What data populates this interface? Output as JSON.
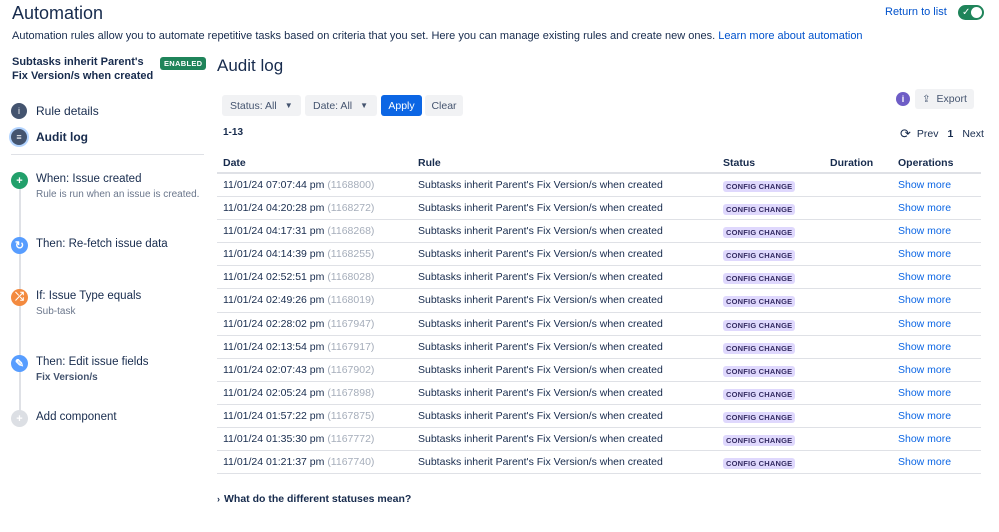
{
  "header": {
    "title": "Automation",
    "description": "Automation rules allow you to automate repetitive tasks based on criteria that you set. Here you can manage existing rules and create new ones.",
    "learn_more": "Learn more about automation",
    "return_link": "Return to list",
    "rule_toggle_on": true
  },
  "sidebar": {
    "rule_name": "Subtasks inherit Parent's Fix Version/s when created",
    "badge": "ENABLED",
    "nav": [
      {
        "label": "Rule details",
        "icon": "info-icon"
      },
      {
        "label": "Audit log",
        "icon": "log-icon",
        "active": true
      }
    ],
    "flow": [
      {
        "title": "When: Issue created",
        "sub": "Rule is run when an issue is created.",
        "icon": "plus-icon",
        "color": "#22a06b"
      },
      {
        "title": "Then: Re-fetch issue data",
        "sub": "",
        "icon": "refresh-icon",
        "color": "#579dff"
      },
      {
        "title": "If: Issue Type equals",
        "sub": "Sub-task",
        "icon": "branch-icon",
        "color": "#f38a3f"
      },
      {
        "title": "Then: Edit issue fields",
        "sub": "Fix Version/s",
        "icon": "pencil-icon",
        "color": "#579dff"
      },
      {
        "title": "Add component",
        "sub": "",
        "icon": "plus-icon",
        "color": "#dcdfe4"
      }
    ]
  },
  "main": {
    "title": "Audit log",
    "filters": {
      "status": "Status: All",
      "date": "Date: All",
      "apply": "Apply",
      "clear": "Clear"
    },
    "export": "Export",
    "range": "1-13",
    "pager": {
      "prev": "Prev",
      "page": "1",
      "next": "Next"
    },
    "columns": [
      "Date",
      "Rule",
      "Status",
      "Duration",
      "Operations"
    ],
    "rows": [
      {
        "date": "11/01/24 07:07:44 pm",
        "id": "(1168800)",
        "rule": "Subtasks inherit Parent's Fix Version/s when created",
        "status": "CONFIG CHANGE",
        "duration": "",
        "op": "Show more"
      },
      {
        "date": "11/01/24 04:20:28 pm",
        "id": "(1168272)",
        "rule": "Subtasks inherit Parent's Fix Version/s when created",
        "status": "CONFIG CHANGE",
        "duration": "",
        "op": "Show more"
      },
      {
        "date": "11/01/24 04:17:31 pm",
        "id": "(1168268)",
        "rule": "Subtasks inherit Parent's Fix Version/s when created",
        "status": "CONFIG CHANGE",
        "duration": "",
        "op": "Show more"
      },
      {
        "date": "11/01/24 04:14:39 pm",
        "id": "(1168255)",
        "rule": "Subtasks inherit Parent's Fix Version/s when created",
        "status": "CONFIG CHANGE",
        "duration": "",
        "op": "Show more"
      },
      {
        "date": "11/01/24 02:52:51 pm",
        "id": "(1168028)",
        "rule": "Subtasks inherit Parent's Fix Version/s when created",
        "status": "CONFIG CHANGE",
        "duration": "",
        "op": "Show more"
      },
      {
        "date": "11/01/24 02:49:26 pm",
        "id": "(1168019)",
        "rule": "Subtasks inherit Parent's Fix Version/s when created",
        "status": "CONFIG CHANGE",
        "duration": "",
        "op": "Show more"
      },
      {
        "date": "11/01/24 02:28:02 pm",
        "id": "(1167947)",
        "rule": "Subtasks inherit Parent's Fix Version/s when created",
        "status": "CONFIG CHANGE",
        "duration": "",
        "op": "Show more"
      },
      {
        "date": "11/01/24 02:13:54 pm",
        "id": "(1167917)",
        "rule": "Subtasks inherit Parent's Fix Version/s when created",
        "status": "CONFIG CHANGE",
        "duration": "",
        "op": "Show more"
      },
      {
        "date": "11/01/24 02:07:43 pm",
        "id": "(1167902)",
        "rule": "Subtasks inherit Parent's Fix Version/s when created",
        "status": "CONFIG CHANGE",
        "duration": "",
        "op": "Show more"
      },
      {
        "date": "11/01/24 02:05:24 pm",
        "id": "(1167898)",
        "rule": "Subtasks inherit Parent's Fix Version/s when created",
        "status": "CONFIG CHANGE",
        "duration": "",
        "op": "Show more"
      },
      {
        "date": "11/01/24 01:57:22 pm",
        "id": "(1167875)",
        "rule": "Subtasks inherit Parent's Fix Version/s when created",
        "status": "CONFIG CHANGE",
        "duration": "",
        "op": "Show more"
      },
      {
        "date": "11/01/24 01:35:30 pm",
        "id": "(1167772)",
        "rule": "Subtasks inherit Parent's Fix Version/s when created",
        "status": "CONFIG CHANGE",
        "duration": "",
        "op": "Show more"
      },
      {
        "date": "11/01/24 01:21:37 pm",
        "id": "(1167740)",
        "rule": "Subtasks inherit Parent's Fix Version/s when created",
        "status": "CONFIG CHANGE",
        "duration": "",
        "op": "Show more"
      }
    ],
    "faq": "What do the different statuses mean?"
  }
}
